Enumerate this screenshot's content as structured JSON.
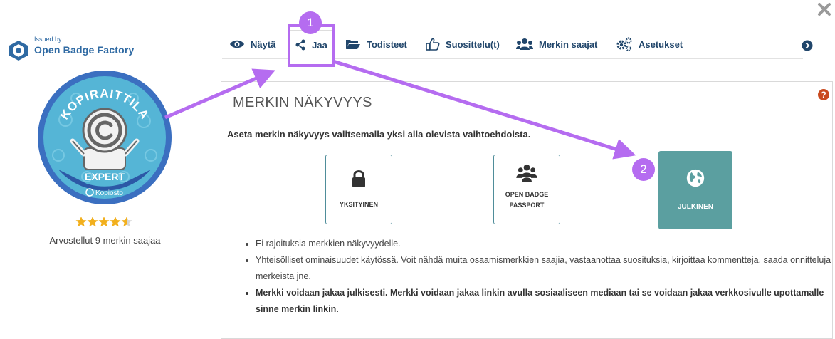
{
  "issuer": {
    "issued_by": "Issued by",
    "name": "Open Badge Factory"
  },
  "badge": {
    "top_text": "KOPIRAITTILA",
    "level": "EXPERT",
    "brand": "Kopiosto"
  },
  "rating": {
    "stars": 4.5,
    "max": 5,
    "text": "Arvostellut 9 merkin saajaa"
  },
  "tabs": [
    {
      "label": "Näytä",
      "icon": "eye-icon"
    },
    {
      "label": "Jaa",
      "icon": "share-icon",
      "active": true
    },
    {
      "label": "Todisteet",
      "icon": "folder-icon"
    },
    {
      "label": "Suosittelu(t)",
      "icon": "thumbs-up-icon"
    },
    {
      "label": "Merkin saajat",
      "icon": "users-icon"
    },
    {
      "label": "Asetukset",
      "icon": "cogs-icon"
    }
  ],
  "annotations": {
    "step1": "1",
    "step2": "2",
    "highlight_color": "#b56cf0"
  },
  "panel": {
    "title": "MERKIN NÄKYVYYS",
    "help": "?",
    "instruction": "Aseta merkin näkyvyys valitsemalla yksi alla olevista vaihtoehdoista.",
    "options": [
      {
        "label": "YKSITYINEN",
        "icon": "lock-icon",
        "selected": false
      },
      {
        "label_line1": "OPEN BADGE",
        "label_line2": "PASSPORT",
        "icon": "group-icon",
        "selected": false
      },
      {
        "label": "JULKINEN",
        "icon": "globe-icon",
        "selected": true
      }
    ],
    "details": [
      "Ei rajoituksia merkkien näkyvyydelle.",
      "Yhteisölliset ominaisuudet käytössä. Voit nähdä muita osaamismerkkien saajia, vastaanottaa suosituksia, kirjoittaa kommentteja, saada onnitteluja merkeista jne.",
      "Merkki voidaan jakaa julkisesti. Merkki voidaan jakaa linkin avulla sosiaaliseen mediaan tai se voidaan jakaa verkkosivulle upottamalle sinne merkin linkin."
    ]
  },
  "colors": {
    "accent": "#21466b",
    "selected_option": "#5b9fa0",
    "help": "#c9491e"
  }
}
